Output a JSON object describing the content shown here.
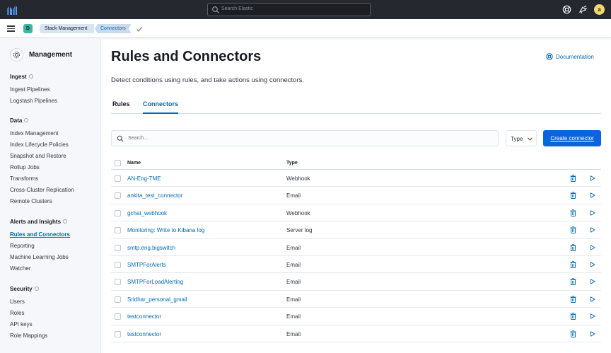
{
  "header": {
    "search_placeholder": "Search Elastic",
    "avatar_initial": "a"
  },
  "subheader": {
    "space_initial": "D",
    "breadcrumbs": [
      "Stack Management",
      "Connectors"
    ]
  },
  "sidebar": {
    "title": "Management",
    "groups": [
      {
        "label": "Ingest",
        "items": [
          "Ingest Pipelines",
          "Logstash Pipelines"
        ]
      },
      {
        "label": "Data",
        "items": [
          "Index Management",
          "Index Lifecycle Policies",
          "Snapshot and Restore",
          "Rollup Jobs",
          "Transforms",
          "Cross-Cluster Replication",
          "Remote Clusters"
        ]
      },
      {
        "label": "Alerts and Insights",
        "items": [
          "Rules and Connectors",
          "Reporting",
          "Machine Learning Jobs",
          "Watcher"
        ]
      },
      {
        "label": "Security",
        "items": [
          "Users",
          "Roles",
          "API keys",
          "Role Mappings"
        ]
      }
    ],
    "active_item": "Rules and Connectors"
  },
  "main": {
    "title": "Rules and Connectors",
    "documentation_link": "Documentation",
    "description": "Detect conditions using rules, and take actions using connectors.",
    "tabs": [
      {
        "label": "Rules",
        "selected": false
      },
      {
        "label": "Connectors",
        "selected": true
      }
    ],
    "search_placeholder": "Search...",
    "type_filter_label": "Type",
    "create_button_label": "Create connector",
    "table": {
      "columns": [
        "Name",
        "Type"
      ],
      "rows": [
        {
          "name": "AN-Eng-TME",
          "type": "Webhook"
        },
        {
          "name": "ankita_test_connector",
          "type": "Email"
        },
        {
          "name": "gchat_webhook",
          "type": "Webhook"
        },
        {
          "name": "Monitoring: Write to Kibana log",
          "type": "Server log"
        },
        {
          "name": "smtp.eng.bigswitch",
          "type": "Email"
        },
        {
          "name": "SMTPForAlerts",
          "type": "Email"
        },
        {
          "name": "SMTPForLoadAlerting",
          "type": "Email"
        },
        {
          "name": "Sridhar_personal_gmail",
          "type": "Email"
        },
        {
          "name": "testconnector",
          "type": "Email"
        },
        {
          "name": "testconnector",
          "type": "Email"
        }
      ]
    }
  },
  "colors": {
    "header_bg": "#25282f",
    "link": "#006bb8",
    "primary_button": "#0b64dd",
    "space_badge": "#36b9a0",
    "avatar": "#f1d86f"
  },
  "icons": [
    "elastic-logo-icon",
    "search-icon",
    "help-icon",
    "newsfeed-icon",
    "menu-icon",
    "check-icon",
    "gear-icon",
    "documentation-icon",
    "chevron-down-icon",
    "trash-icon",
    "play-icon"
  ]
}
